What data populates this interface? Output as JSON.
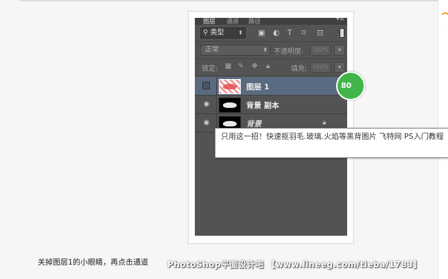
{
  "photoshop_layers_panel": {
    "tabs": [
      {
        "label": "图层",
        "active": true
      },
      {
        "label": "通道",
        "active": false
      },
      {
        "label": "路径",
        "active": false
      }
    ],
    "filter": {
      "kind_label": "类型"
    },
    "blend_mode": {
      "value": "正常"
    },
    "opacity": {
      "label": "不透明度:",
      "value": "100%"
    },
    "lock": {
      "label": "锁定:"
    },
    "fill": {
      "label": "填充:",
      "value": "100%"
    },
    "layers": [
      {
        "name": "图层 1",
        "selected": true,
        "visible": false
      },
      {
        "name": "背景 副本",
        "selected": false,
        "visible": true
      },
      {
        "name": "背景",
        "selected": false,
        "visible": true,
        "locked": true
      }
    ]
  },
  "badge": {
    "text": "80"
  },
  "tooltip": {
    "text": "只用这一招！快速抠羽毛.玻璃.火焰等黑背图片 飞特网 PS入门教程"
  },
  "caption": {
    "text": "关掉图层1的小眼睛，再点击通道"
  },
  "watermark": {
    "text": "PhotoShop平面设计吧 【www.lineeg.com/tieba/1783】"
  },
  "colors": {
    "panel_bg": "#535353",
    "selected_layer": "#5a6a80",
    "badge_green": "#3fb54a",
    "accent_orange": "#f09a2a"
  }
}
